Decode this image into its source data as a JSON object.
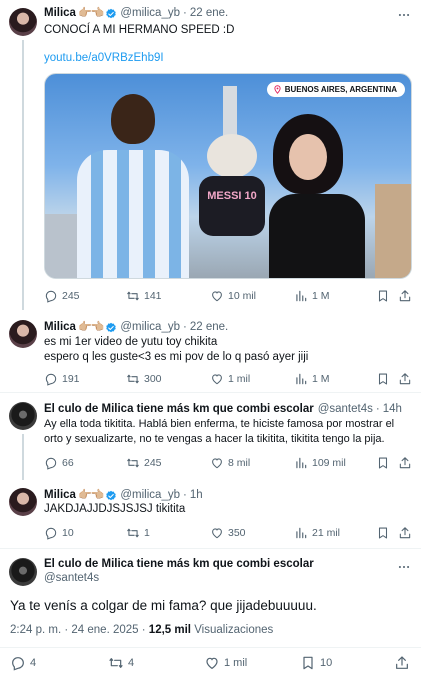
{
  "colors": {
    "accent": "#1d9bf0",
    "muted": "#536471",
    "divider": "#eff3f4"
  },
  "tweets": [
    {
      "name": "Milica",
      "handle": "@milica_yb",
      "dot": "·",
      "date": "22 ene.",
      "text": "CONOCÍ A MI HERMANO SPEED :D",
      "link": "youtu.be/a0VRBzEhb9I",
      "media_location": "BUENOS AIRES, ARGENTINA",
      "jersey_text": "MESSI 10",
      "replies": "245",
      "retweets": "141",
      "likes": "10 mil",
      "views": "1 M"
    },
    {
      "name": "Milica",
      "handle": "@milica_yb",
      "dot": "·",
      "date": "22 ene.",
      "text": "es mi 1er video de yutu toy chikita\nespero q les guste<3 es mi pov de lo q pasó ayer jiji",
      "replies": "191",
      "retweets": "300",
      "likes": "1 mil",
      "views": "1 M"
    },
    {
      "name": "El culo de Milica tiene más km que combi escolar",
      "handle": "@santet4s",
      "dot": "·",
      "date": "14h",
      "text": "Ay ella toda tikitita. Hablá bien enferma, te hiciste famosa por mostrar el\norto y sexualizarte, no te vengas a hacer la tikitita, tikitita tengo la pija.",
      "replies": "66",
      "retweets": "245",
      "likes": "8 mil",
      "views": "109 mil"
    },
    {
      "name": "Milica",
      "handle": "@milica_yb",
      "dot": "·",
      "date": "1h",
      "text": "JAKDJAJJDJSJSJSJ tikitita",
      "replies": "10",
      "retweets": "1",
      "likes": "350",
      "views": "21 mil"
    }
  ],
  "main_tweet": {
    "name": "El culo de Milica tiene más km que combi escolar",
    "handle": "@santet4s",
    "text": "Ya te venís a colgar de mi fama? que jijadebuuuuu.",
    "time": "2:24 p. m.",
    "dot": "·",
    "date": "24 ene. 2025",
    "dot2": "·",
    "views_count": "12,5 mil",
    "views_label": "Visualizaciones",
    "replies": "4",
    "retweets": "4",
    "likes": "1 mil",
    "bookmarks": "10"
  },
  "icons": {
    "reply": "reply-icon",
    "retweet": "retweet-icon",
    "like": "heart-icon",
    "views": "views-icon",
    "bookmark": "bookmark-icon",
    "share": "share-icon",
    "verified": "verified-badge-icon",
    "location": "location-pin-icon"
  }
}
